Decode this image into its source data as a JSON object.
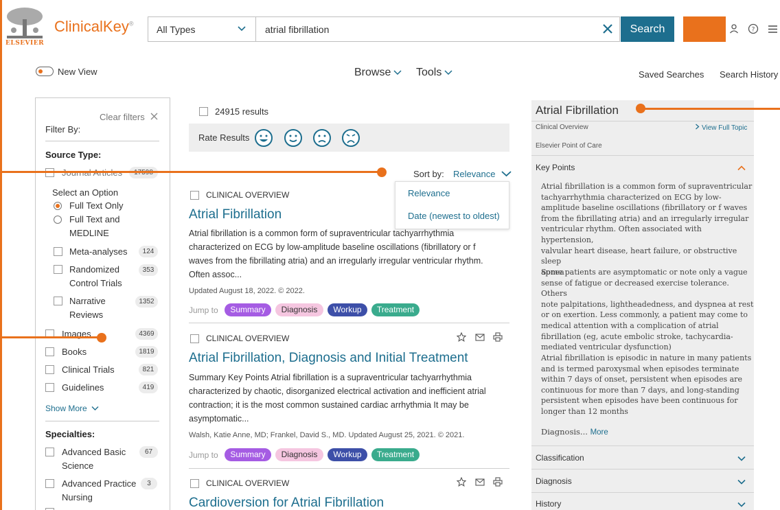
{
  "brand": {
    "name": "ClinicalKey",
    "publisher": "ELSEVIER",
    "reg_mark": "®"
  },
  "search": {
    "type_label": "All Types",
    "query": "atrial fibrillation",
    "button_label": "Search"
  },
  "subheader": {
    "new_view_label": "New View",
    "browse_label": "Browse",
    "tools_label": "Tools",
    "saved_searches": "Saved Searches",
    "search_history": "Search History"
  },
  "filters": {
    "clear_label": "Clear filters",
    "filter_by_label": "Filter By:",
    "source_type_heading": "Source Type:",
    "journal_articles": {
      "label": "Journal Articles",
      "count": "17598"
    },
    "select_option_label": "Select an Option",
    "radio_options": [
      {
        "label": "Full Text Only",
        "selected": true
      },
      {
        "label": "Full Text and MEDLINE",
        "label_line1": "Full Text and",
        "label_line2": "MEDLINE",
        "selected": false
      }
    ],
    "sub_items": [
      {
        "label": "Meta-analyses",
        "count": "124"
      },
      {
        "label": "Randomized Control Trials",
        "label_line1": "Randomized",
        "label_line2": "Control Trials",
        "count": "353"
      },
      {
        "label": "Narrative Reviews",
        "label_line1": "Narrative",
        "label_line2": "Reviews",
        "count": "1352"
      }
    ],
    "source_items": [
      {
        "label": "Images",
        "count": "4369"
      },
      {
        "label": "Books",
        "count": "1819"
      },
      {
        "label": "Clinical Trials",
        "count": "821"
      },
      {
        "label": "Guidelines",
        "count": "419"
      }
    ],
    "show_more_label": "Show More",
    "specialties_heading": "Specialties:",
    "specialty_items": [
      {
        "label": "Advanced Basic Science",
        "label_line1": "Advanced Basic",
        "label_line2": "Science",
        "count": "67"
      },
      {
        "label": "Advanced Practice Nursing",
        "label_line1": "Advanced Practice",
        "label_line2": "Nursing",
        "count": "3"
      }
    ]
  },
  "results": {
    "count_label": "24915 results",
    "rate_label": "Rate Results",
    "sort_label": "Sort by:",
    "sort_value": "Relevance",
    "sort_options": [
      "Relevance",
      "Date (newest to oldest)"
    ],
    "jump_label": "Jump to",
    "pills": {
      "summary": "Summary",
      "diagnosis": "Diagnosis",
      "workup": "Workup",
      "treatment": "Treatment"
    },
    "items": [
      {
        "type": "CLINICAL OVERVIEW",
        "title": "Atrial Fibrillation",
        "body_lines": [
          "Atrial fibrillation is a common form of supraventricular tachyarrhythmia",
          "characterized on ECG by low-amplitude baseline oscillations (fibrillatory or f",
          "waves from the fibrillating atria) and an irregularly irregular ventricular rhythm.",
          "Often assoc..."
        ],
        "meta": "Updated August 18, 2022. © 2022."
      },
      {
        "type": "CLINICAL OVERVIEW",
        "title": "Atrial Fibrillation, Diagnosis and Initial Treatment",
        "body_lines": [
          "Summary Key Points Atrial fibrillation is a supraventricular tachyarrhythmia",
          "characterized by chaotic, disorganized electrical activation and inefficient atrial",
          "contraction; it is the most common sustained cardiac arrhythmia It may be",
          "asymptomatic..."
        ],
        "meta": "Walsh, Katie Anne, MD; Frankel, David S., MD. Updated August 25, 2021. © 2021."
      },
      {
        "type": "CLINICAL OVERVIEW",
        "title": "Cardioversion for Atrial Fibrillation"
      }
    ]
  },
  "topic": {
    "title": "Atrial Fibrillation",
    "subtitle": "Clinical Overview",
    "view_full": "View Full Topic",
    "source": "Elsevier Point of Care",
    "key_points_label": "Key Points",
    "p1_lines": [
      "Atrial fibrillation is a common form of supraventricular",
      "tachyarrhythmia characterized on ECG by low-",
      "amplitude baseline oscillations (fibrillatory or f waves",
      "from the fibrillating atria) and an irregularly irregular",
      "ventricular rhythm. Often associated with hypertension,",
      "valvular heart disease, heart failure, or obstructive sleep",
      "apnea"
    ],
    "p2_lines": [
      "Some patients are asymptomatic or note only a vague",
      "sense of fatigue or decreased exercise tolerance. Others",
      "note palpitations, lightheadedness, and dyspnea at rest",
      "or on exertion. Less commonly, a patient may come to",
      "medical attention with a complication of atrial",
      "fibrillation (eg, acute embolic stroke, tachycardia-",
      "mediated ventricular dysfunction)"
    ],
    "p3_lines": [
      "Atrial fibrillation is episodic in nature in many patients",
      "and is termed paroxysmal when episodes terminate",
      "within 7 days of onset, persistent when episodes are",
      "continuous for more than 7 days, and long-standing",
      "persistent when episodes have been continuous for",
      "longer than 12 months"
    ],
    "diagnosis_teaser": "Diagnosis...",
    "more_label": "More",
    "sections": [
      "Classification",
      "Diagnosis",
      "History"
    ]
  },
  "colors": {
    "accent": "#e9711c",
    "primary": "#1d6e8e"
  }
}
